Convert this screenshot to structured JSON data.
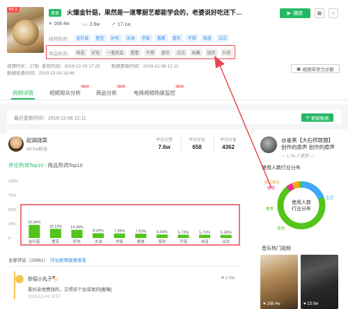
{
  "video": {
    "score": "94.1",
    "category": "美食",
    "title": "火爆金针菇，果然是一道零厨艺都能学会的，老婆说好吃还下…",
    "likes": "168.4w",
    "comments": "2.6w",
    "shares": "17.1w",
    "hot_words_label": "视频热词：",
    "hot_words": [
      "金针菇",
      "整花",
      "好吃",
      "太油",
      "学废",
      "看看",
      "喜欢",
      "不错",
      "味道",
      "试试"
    ],
    "product_words_label": "商品热词：",
    "product_words": [
      "味道",
      "好吃",
      "一看就会",
      "看看",
      "不错",
      "喜欢",
      "试试",
      "收藏",
      "接您",
      "抖音"
    ],
    "duration_label": "视频时长：27秒",
    "publish_label": "发布时间：2019-12-03 17:25",
    "update_label": "数据更新时间：2019-12-06 12:11",
    "collect_label": "数据收录时间：2019-12-03 19:46"
  },
  "actions": {
    "play": "播放",
    "diagnose": "视频带货力诊断"
  },
  "tabs": [
    {
      "label": "视频详情",
      "new": ""
    },
    {
      "label": "视频观众分析",
      "new": "NEW"
    },
    {
      "label": "商品分析",
      "new": "NEW"
    },
    {
      "label": "电商视频热度监控",
      "new": "NEW"
    }
  ],
  "update_bar": {
    "text": "最近更新时间：2019-12-06 12:11",
    "button": "更新数据"
  },
  "author": {
    "name": "起锅烧菜",
    "fans": "68.5w粉丝",
    "kpis": [
      {
        "label": "平均点赞",
        "value": "7.6w"
      },
      {
        "label": "平均评论",
        "value": "658"
      },
      {
        "label": "平均分享",
        "value": "4362"
      }
    ]
  },
  "section": {
    "active": "评论热词Top10",
    "sep": "|",
    "other": "商品热词Top10"
  },
  "chart_data": {
    "type": "bar",
    "categories": [
      "金针菇",
      "整花",
      "好吃",
      "太油",
      "学废",
      "看看",
      "喜欢",
      "不错",
      "味道",
      "试试"
    ],
    "values": [
      22.94,
      16.13,
      14.34,
      8.24,
      7.89,
      7.53,
      6.09,
      5.73,
      5.73,
      5.38
    ],
    "labels": [
      "22.94%",
      "16.13%",
      "14.34%",
      "8.24%",
      "7.89%",
      "7.53%",
      "6.09%",
      "5.73%",
      "5.73%",
      "5.38%"
    ],
    "yticks": [
      "100%",
      "75%",
      "50%",
      "25%",
      "0"
    ],
    "ylim": [
      0,
      100
    ],
    "color": "#52c41a"
  },
  "comments": {
    "header": "全部评论（25961）",
    "link": "评论剧情画像查看",
    "items": [
      {
        "name": "妙招小丸子🍢",
        "text": "看抖音觉费钱的，又得买个拉菲斑的[撇嘴]",
        "time": "2019-12-04 12:57",
        "likes": "1.9w"
      }
    ]
  },
  "right": {
    "name": "@雀黑【大石桥联盟】",
    "bio": "创作的原声  创作的原声",
    "fans": "— 1.7w 人使用 —",
    "section1": "使用人数行业分布",
    "donut_center": [
      "使用人数",
      "行业分布"
    ],
    "donut_labels": [
      "网红美女",
      "情感",
      "生活",
      "美食",
      "其他"
    ],
    "section2": "音乐热门视频",
    "videos": [
      {
        "stat": "168.4w"
      },
      {
        "stat": "23.0w"
      }
    ]
  }
}
